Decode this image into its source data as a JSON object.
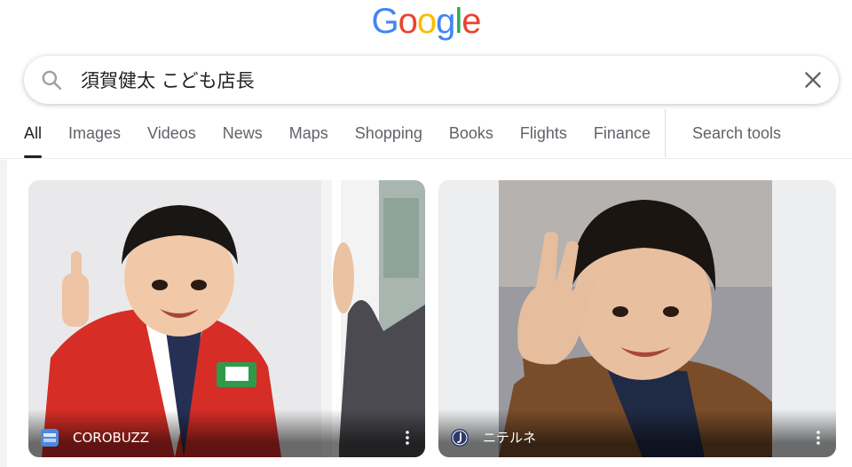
{
  "logo": {
    "letters": [
      "G",
      "o",
      "o",
      "g",
      "l",
      "e"
    ],
    "colors": [
      "#4285F4",
      "#EA4335",
      "#FBBC05",
      "#4285F4",
      "#34A853",
      "#EA4335"
    ]
  },
  "search": {
    "query": "須賀健太 こども店長",
    "icons": {
      "search": "search-icon",
      "clear": "close-icon"
    }
  },
  "tabs": [
    {
      "label": "All",
      "active": true
    },
    {
      "label": "Images"
    },
    {
      "label": "Videos"
    },
    {
      "label": "News"
    },
    {
      "label": "Maps"
    },
    {
      "label": "Shopping"
    },
    {
      "label": "Books"
    },
    {
      "label": "Flights"
    },
    {
      "label": "Finance"
    }
  ],
  "search_tools": {
    "label": "Search tools"
  },
  "results": [
    {
      "source": "COROBUZZ",
      "favicon": "corobuzz-favicon",
      "more": "more-vert-icon"
    },
    {
      "source": "ニテルネ",
      "favicon": "niterune-favicon",
      "more": "more-vert-icon"
    }
  ]
}
